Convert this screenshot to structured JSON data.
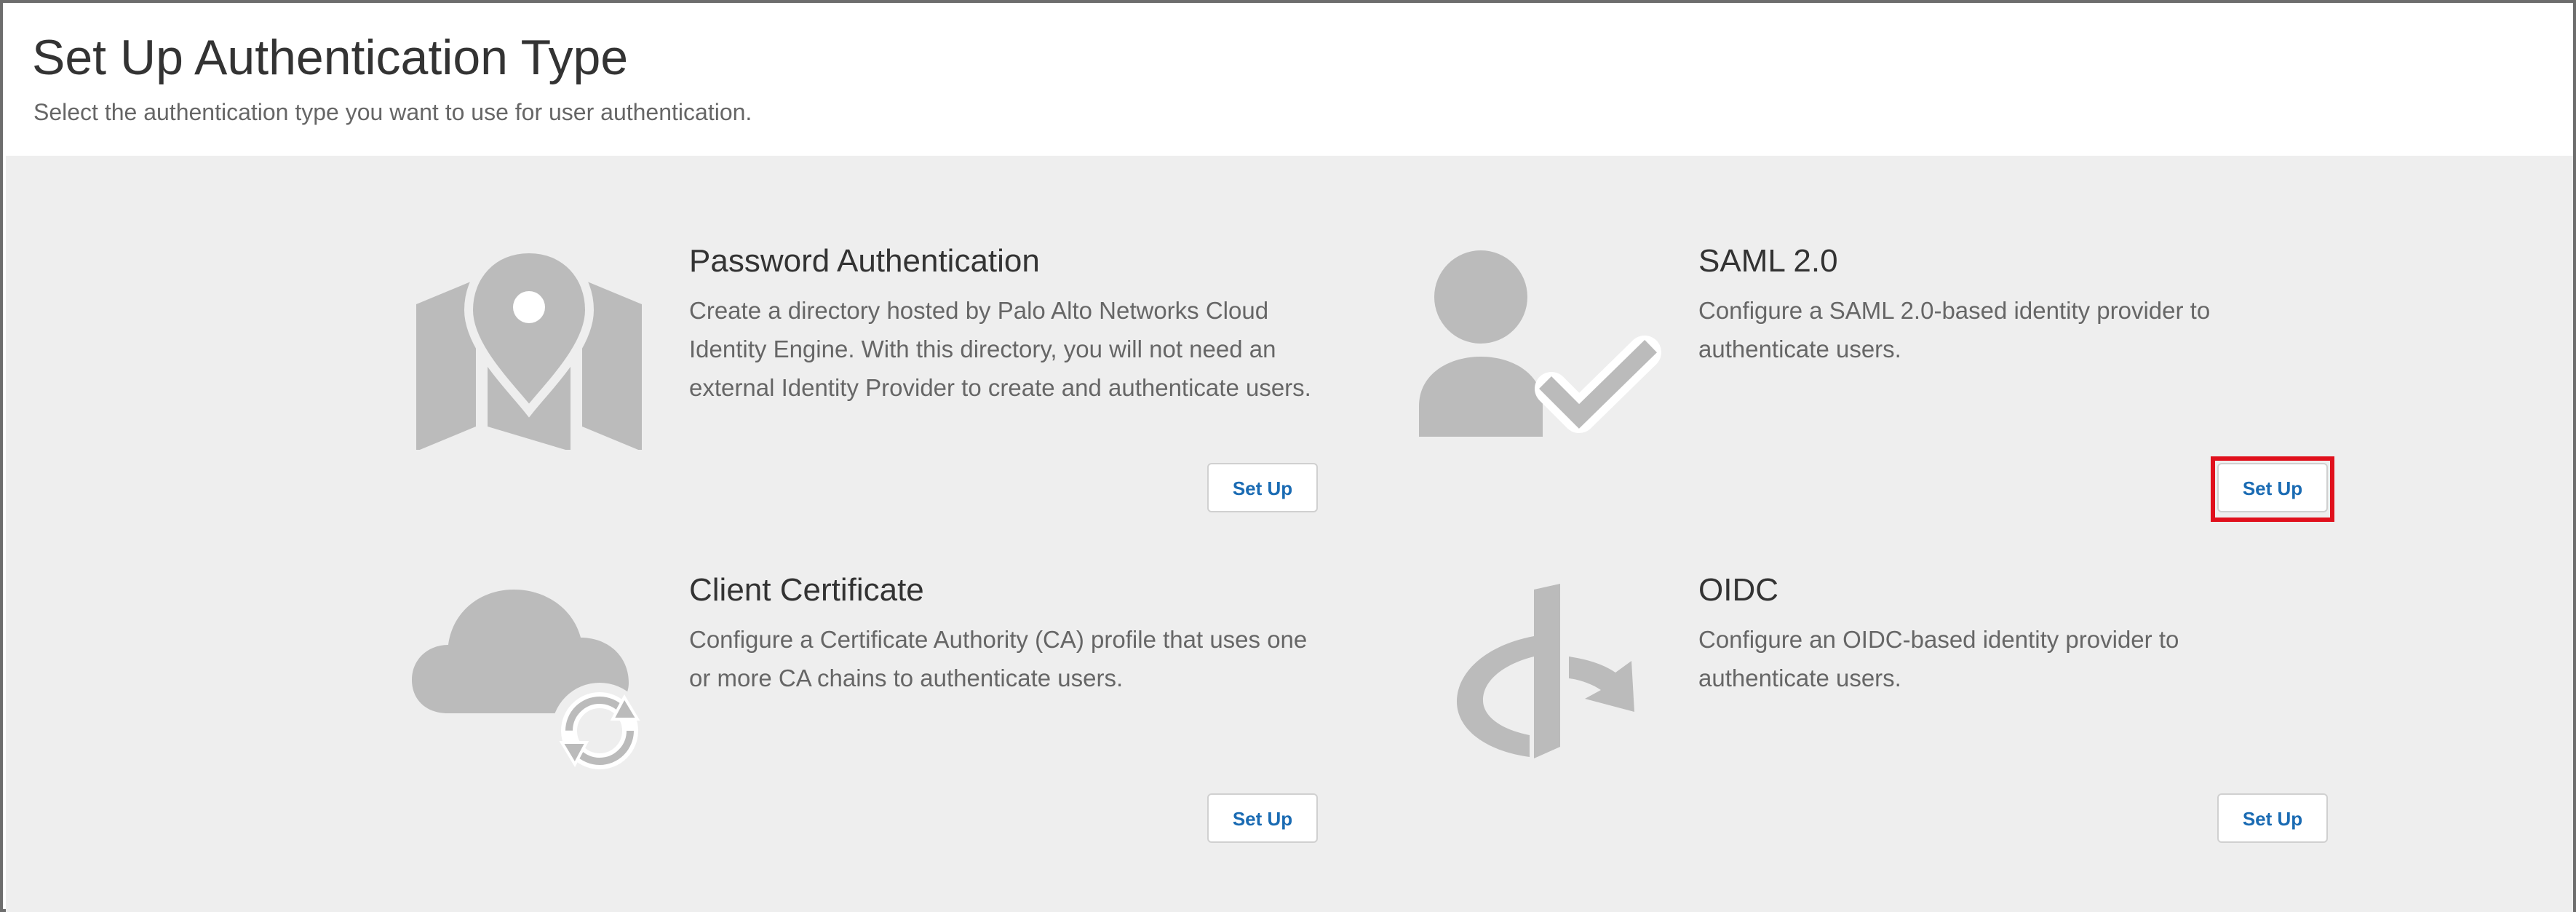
{
  "header": {
    "title": "Set Up Authentication Type",
    "subtitle": "Select the authentication type you want to use for user authentication."
  },
  "cards": [
    {
      "title": "Password Authentication",
      "description": "Create a directory hosted by Palo Alto Networks Cloud Identity Engine. With this directory, you will not need an external Identity Provider to create and authenticate users.",
      "button_label": "Set Up",
      "icon": "map-pin-icon"
    },
    {
      "title": "SAML 2.0",
      "description": "Configure a SAML 2.0-based identity provider to authenticate users.",
      "button_label": "Set Up",
      "icon": "user-check-icon",
      "highlighted": true
    },
    {
      "title": "Client Certificate",
      "description": "Configure a Certificate Authority (CA) profile that uses one or more CA chains to authenticate users.",
      "button_label": "Set Up",
      "icon": "cloud-sync-icon"
    },
    {
      "title": "OIDC",
      "description": "Configure an OIDC-based identity provider to authenticate users.",
      "button_label": "Set Up",
      "icon": "openid-icon"
    }
  ],
  "colors": {
    "icon_gray": "#bbbbbb",
    "link_blue": "#1a6bb3",
    "highlight_red": "#e0101c",
    "panel_bg": "#eeeeee"
  }
}
